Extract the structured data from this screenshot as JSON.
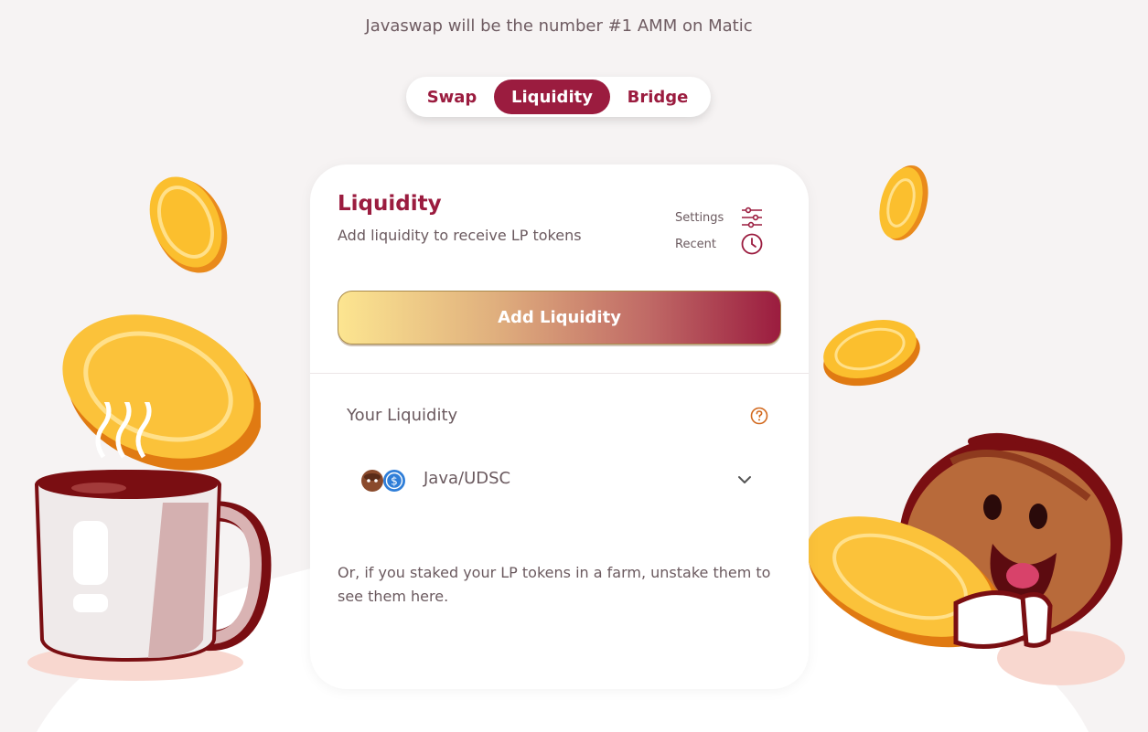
{
  "header": {
    "tagline": "Javaswap will be the number #1 AMM on Matic"
  },
  "nav": {
    "tabs": [
      {
        "label": "Swap",
        "active": false
      },
      {
        "label": "Liquidity",
        "active": true
      },
      {
        "label": "Bridge",
        "active": false
      }
    ]
  },
  "card": {
    "title": "Liquidity",
    "subtitle": "Add liquidity to receive LP tokens",
    "settings_label": "Settings",
    "recent_label": "Recent",
    "settings_icon": "sliders-icon",
    "recent_icon": "clock-icon",
    "add_button_label": "Add Liquidity",
    "your_liquidity_label": "Your Liquidity",
    "help_icon": "question-circle-icon",
    "pairs": [
      {
        "name": "Java/UDSC",
        "token_icons": [
          "java-bean-icon",
          "usdc-icon"
        ],
        "expand_icon": "chevron-down-icon"
      }
    ],
    "staked_note": "Or, if you staked your LP tokens in a farm, unstake them to see them here."
  },
  "colors": {
    "brand": "#9b1c3f",
    "gradient_start": "#fce590",
    "gradient_end": "#9b1c3f",
    "background": "#f6f3f3"
  }
}
